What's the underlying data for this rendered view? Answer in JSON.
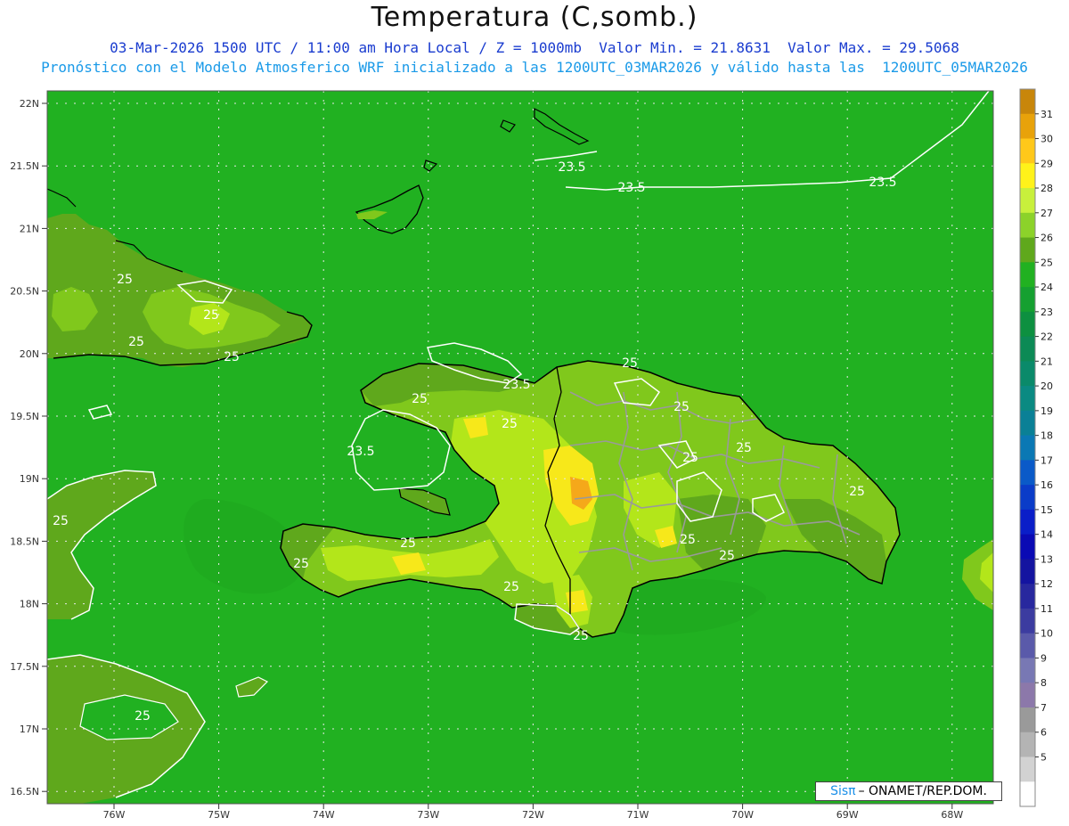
{
  "header": {
    "title": "Temperatura (C,somb.)",
    "line1": "03-Mar-2026 1500 UTC / 11:00 am Hora Local / Z = 1000mb  Valor Min. = 21.8631  Valor Max. = 29.5068",
    "line2": "Pronóstico con el Modelo Atmosferico WRF inicializado a las 1200UTC_03MAR2026 y válido hasta las  1200UTC_05MAR2026"
  },
  "map": {
    "lat_labels": [
      "22N",
      "21.5N",
      "21N",
      "20.5N",
      "20N",
      "19.5N",
      "19N",
      "18.5N",
      "18N",
      "17.5N",
      "17N",
      "16.5N"
    ],
    "lon_labels": [
      "76W",
      "75W",
      "74W",
      "73W",
      "72W",
      "71W",
      "70W",
      "69W",
      "68W"
    ],
    "contour_labels": [
      "23.5",
      "23.5",
      "23.5",
      "23.5",
      "23.5",
      "25",
      "25",
      "25",
      "25",
      "25",
      "25",
      "25",
      "25",
      "25",
      "25",
      "25",
      "25",
      "25",
      "25",
      "25",
      "25",
      "25"
    ],
    "colors": {
      "ocean": "#21b121",
      "land_low": "#5fa81c",
      "land_mid": "#80c81c",
      "land_high": "#b3e61a",
      "peak": "#f7e81a",
      "hot": "#f5a81a",
      "coast": "#000000",
      "border": "#9a9a9a",
      "contour": "#ffffff"
    }
  },
  "colorbar": {
    "ticks": [
      "31",
      "30",
      "29",
      "28",
      "27",
      "26",
      "25",
      "24",
      "23",
      "22",
      "21",
      "20",
      "19",
      "18",
      "17",
      "16",
      "15",
      "14",
      "13",
      "12",
      "11",
      "10",
      "9",
      "8",
      "7",
      "6",
      "5"
    ],
    "colors": [
      "#c8860a",
      "#e8a20a",
      "#ffc81a",
      "#fff21a",
      "#c8f03c",
      "#8cd22a",
      "#5fa81c",
      "#21b121",
      "#15a030",
      "#0d9040",
      "#0c8a55",
      "#0a8a6a",
      "#0a8a82",
      "#0a8096",
      "#0a78b4",
      "#0a5ac8",
      "#0a3cc8",
      "#0a1ec8",
      "#0a0ab4",
      "#1414a0",
      "#28289e",
      "#3c3ca0",
      "#5a5aaa",
      "#7878b4",
      "#8c78aa",
      "#9a9a9a",
      "#b4b4b4",
      "#d2d2d2",
      "#ffffff"
    ]
  },
  "credit": {
    "sis": "Sisπ",
    "text": "– ONAMET/REP.DOM."
  }
}
